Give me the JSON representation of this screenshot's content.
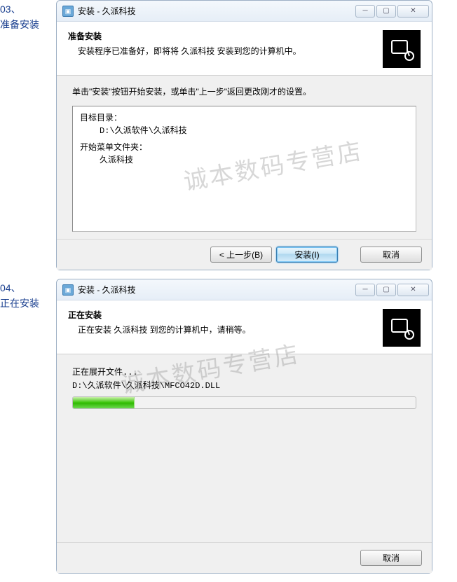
{
  "watermark": "诚本数码专营店",
  "step1": {
    "label_num": "03、",
    "label_text": "准备安装",
    "title": "安装 - 久派科技",
    "header_title": "准备安装",
    "header_sub": "安装程序已准备好，即将将 久派科技 安装到您的计算机中。",
    "instruction": "单击\"安装\"按钮开始安装，或单击\"上一步\"返回更改刚才的设置。",
    "info_l1": "目标目录：",
    "info_l2": "D:\\久派软件\\久派科技",
    "info_l3": "开始菜单文件夹：",
    "info_l4": "久派科技",
    "btn_back": "< 上一步(B)",
    "btn_install": "安装(I)",
    "btn_cancel": "取消"
  },
  "step2": {
    "label_num": "04、",
    "label_text": "正在安装",
    "title": "安装 - 久派科技",
    "header_title": "正在安装",
    "header_sub": "正在安装 久派科技 到您的计算机中，请稍等。",
    "extract_label": "正在展开文件...",
    "extract_path": "D:\\久派软件\\久派科技\\MFCO42D.DLL",
    "progress_pct": 18,
    "btn_cancel": "取消"
  }
}
